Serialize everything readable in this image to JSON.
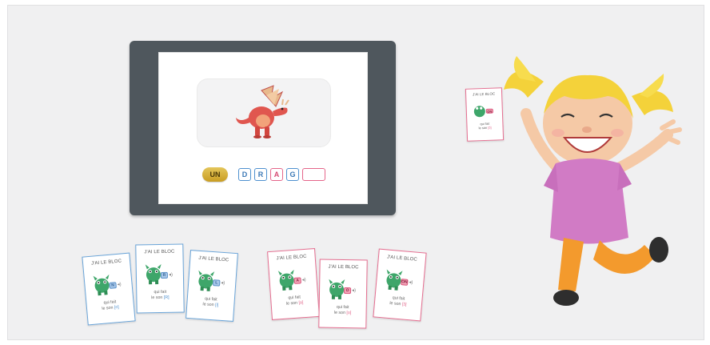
{
  "tablet": {
    "article": "UN",
    "letters": [
      "D",
      "R",
      "A",
      "G",
      ""
    ],
    "letter_colors": [
      "blue",
      "blue",
      "pink",
      "blue",
      "pink"
    ]
  },
  "cards": [
    {
      "head": "J'AI LE BLOC",
      "badge": "N",
      "foot1": "qui fait",
      "foot2": "le son",
      "sound": "[n]",
      "color": "blue"
    },
    {
      "head": "J'AI LE BLOC",
      "badge": "R",
      "foot1": "qui fait",
      "foot2": "le son",
      "sound": "[R]",
      "color": "blue"
    },
    {
      "head": "J'AI LE BLOC",
      "badge": "L",
      "foot1": "qui fait",
      "foot2": "le son",
      "sound": "[l]",
      "color": "blue"
    },
    {
      "head": "J'AI LE BLOC",
      "badge": "A",
      "foot1": "qui fait",
      "foot2": "le son",
      "sound": "[a]",
      "color": "pink"
    },
    {
      "head": "J'AI LE BLOC",
      "badge": "O",
      "foot1": "qui fait",
      "foot2": "le son",
      "sound": "[o]",
      "color": "pink"
    },
    {
      "head": "J'AI LE BLOC",
      "badge": "ON",
      "foot1": "qui fait",
      "foot2": "le son",
      "sound": "[ɔ̃]",
      "color": "pink"
    }
  ],
  "held_card": {
    "head": "J'AI LE BLOC",
    "badge": "ON",
    "foot1": "qui fait",
    "foot2": "le son",
    "sound": "[ɔ̃]"
  },
  "colors": {
    "blue": "#4f91cf",
    "pink": "#e5658a",
    "tablet": "#4f575d",
    "dragon": "#e0564f"
  }
}
